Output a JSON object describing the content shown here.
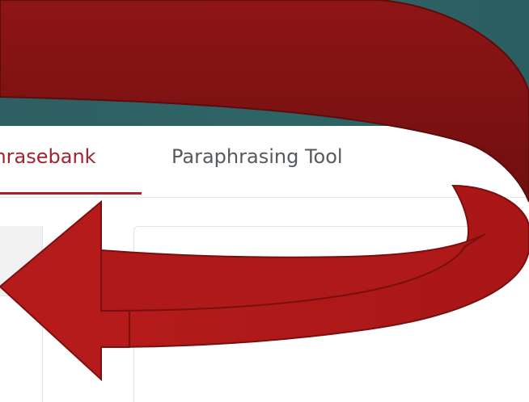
{
  "nav": {
    "tabs": [
      {
        "label": "Phrasebank",
        "active": true
      },
      {
        "label": "Paraphrasing Tool",
        "active": false
      }
    ]
  },
  "colors": {
    "banner": "#2e5f62",
    "active_tab": "#a3242d",
    "arrow_fill": "#b01919",
    "arrow_outline": "#7a0f0f"
  },
  "overlay": {
    "icon": "curved-arrow-icon"
  }
}
